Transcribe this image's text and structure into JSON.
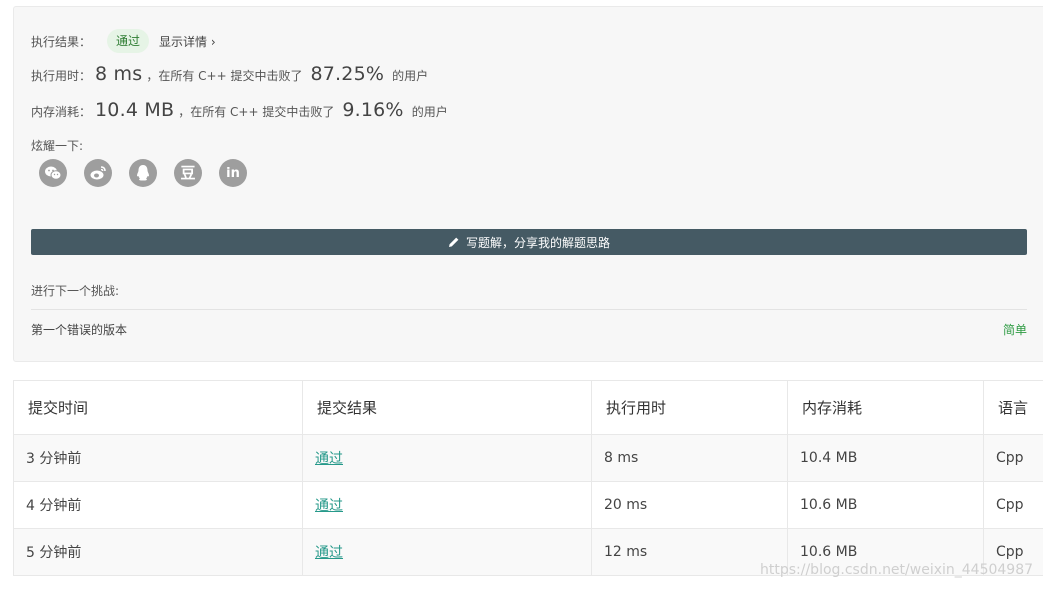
{
  "result": {
    "label": "执行结果：",
    "status": "通过",
    "details_link": "显示详情",
    "details_chevron": "›"
  },
  "runtime": {
    "label": "执行用时：",
    "value": "8 ms",
    "middle": "，在所有 C++ 提交中击败了",
    "percent": "87.25%",
    "suffix": "的用户"
  },
  "memory": {
    "label": "内存消耗：",
    "value": "10.4 MB",
    "middle": "，在所有 C++ 提交中击败了",
    "percent": "9.16%",
    "suffix": "的用户"
  },
  "share": {
    "label": "炫耀一下:",
    "icons": [
      "wechat-icon",
      "weibo-icon",
      "qq-icon",
      "douban-icon",
      "linkedin-icon"
    ],
    "douban_glyph": "豆",
    "linkedin_glyph": "in"
  },
  "write_solution": {
    "label": "写题解，分享我的解题思路"
  },
  "next_challenge": {
    "label": "进行下一个挑战:",
    "problem": "第一个错误的版本",
    "difficulty": "简单"
  },
  "table": {
    "headers": [
      "提交时间",
      "提交结果",
      "执行用时",
      "内存消耗",
      "语言"
    ],
    "rows": [
      [
        "3 分钟前",
        "通过",
        "8 ms",
        "10.4 MB",
        "Cpp"
      ],
      [
        "4 分钟前",
        "通过",
        "20 ms",
        "10.6 MB",
        "Cpp"
      ],
      [
        "5 分钟前",
        "通过",
        "12 ms",
        "10.6 MB",
        "Cpp"
      ]
    ]
  },
  "watermark": "https://blog.csdn.net/weixin_44504987",
  "colors": {
    "accent_green": "#2e7d32",
    "button_bg": "#455a64",
    "link_teal": "#26998a",
    "difficulty_green": "#2e9b43"
  }
}
